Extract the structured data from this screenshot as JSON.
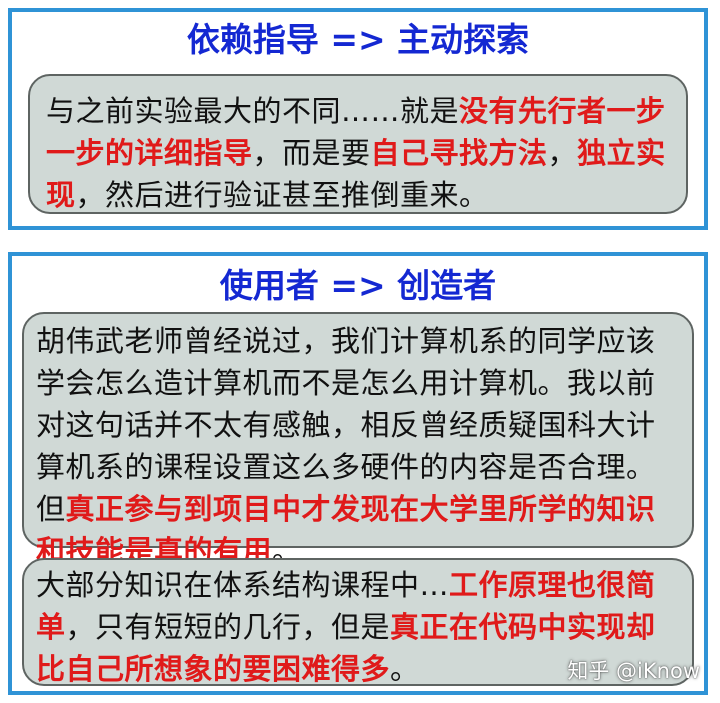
{
  "panel1": {
    "title": "依赖指导 => 主动探索",
    "box": [
      {
        "text": "与之前实验最大的不同……就是",
        "highlight": false
      },
      {
        "text": "没有先行者一步一步的详细指导",
        "highlight": true
      },
      {
        "text": "，而是要",
        "highlight": false
      },
      {
        "text": "自己寻找方法",
        "highlight": true
      },
      {
        "text": "，",
        "highlight": false
      },
      {
        "text": "独立实现",
        "highlight": true
      },
      {
        "text": "，然后进行验证甚至推倒重来。",
        "highlight": false
      }
    ]
  },
  "panel2": {
    "title": "使用者 => 创造者",
    "box1": [
      {
        "text": "胡伟武老师曾经说过，我们计算机系的同学应该学会怎么造计算机而不是怎么用计算机。我以前对这句话并不太有感触，相反曾经质疑国科大计算机系的课程设置这么多硬件的内容是否合理。但",
        "highlight": false
      },
      {
        "text": "真正参与到项目中才发现在大学里所学的知识和技能是真的有用",
        "highlight": true
      },
      {
        "text": "。",
        "highlight": false
      }
    ],
    "box2": [
      {
        "text": "大部分知识在体系结构课程中…",
        "highlight": false
      },
      {
        "text": "工作原理也很简单",
        "highlight": true
      },
      {
        "text": "，只有短短的几行，但是",
        "highlight": false
      },
      {
        "text": "真正在代码中实现却比自己所想象的要困难得多",
        "highlight": true
      },
      {
        "text": "。",
        "highlight": false
      }
    ]
  },
  "watermark": "知乎 @iKnow"
}
